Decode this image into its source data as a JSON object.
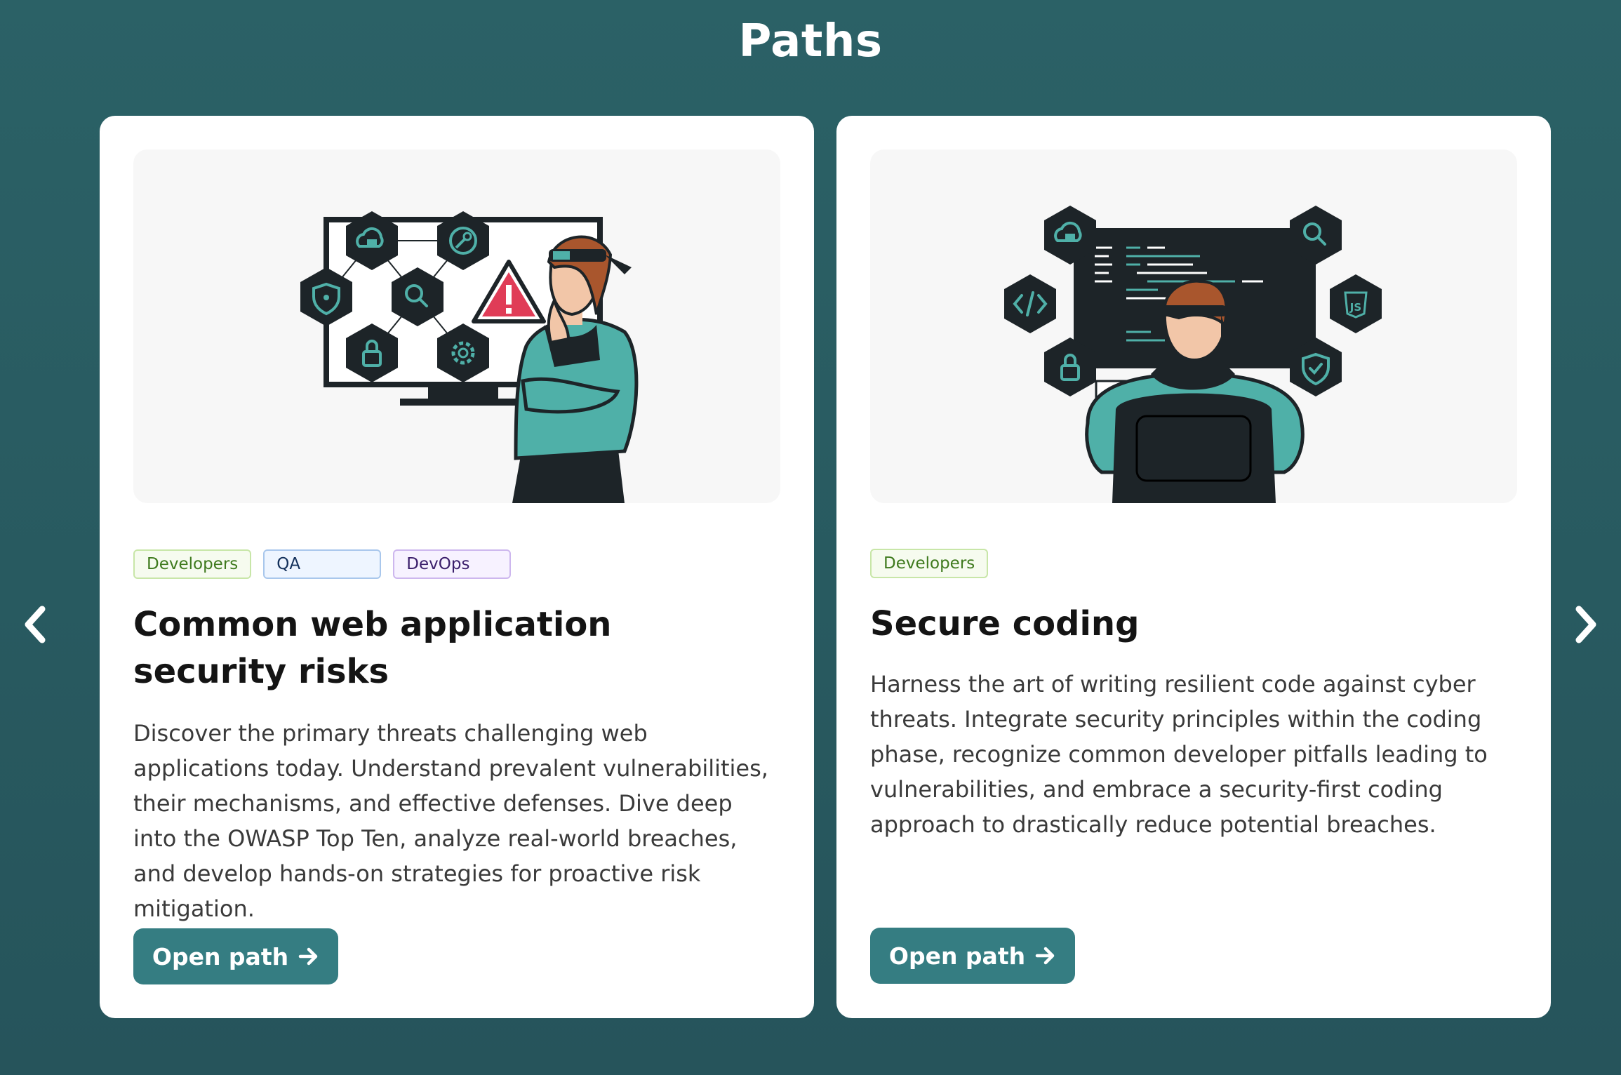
{
  "page": {
    "title": "Paths"
  },
  "carousel": {
    "prev_icon": "chevron-left-icon",
    "next_icon": "chevron-right-icon"
  },
  "colors": {
    "background": "#2b6166",
    "card": "#ffffff",
    "button": "#357d82",
    "accent_teal": "#4fb0a8",
    "icon_hex": "#1d2428",
    "warning_red": "#e03c57"
  },
  "cards": [
    {
      "tags": [
        "Developers",
        "QA",
        "DevOps"
      ],
      "title_line1": "Common web application",
      "title_line2": "security risks",
      "description": "Discover the primary threats challenging web applications today. Understand prevalent vulnerabilities, their mechanisms, and effective defenses. Dive deep into the OWASP Top Ten, analyze real-world breaches, and develop hands-on strategies for proactive risk mitigation.",
      "button_label": "Open path",
      "illustration_icons": [
        "cloud-lock-icon",
        "key-icon",
        "shield-icon",
        "search-icon",
        "lock-icon",
        "gear-icon",
        "warning-icon"
      ]
    },
    {
      "tags": [
        "Developers"
      ],
      "title": "Secure coding",
      "description": "Harness the art of writing resilient code against cyber threats. Integrate security principles within the coding phase, recognize common developer pitfalls leading to vulnerabilities, and embrace a security-first coding approach to drastically reduce potential breaches.",
      "button_label": "Open path",
      "illustration_icons": [
        "cloud-lock-icon",
        "code-icon",
        "lock-icon",
        "search-icon",
        "js-icon",
        "shield-check-icon"
      ]
    }
  ]
}
